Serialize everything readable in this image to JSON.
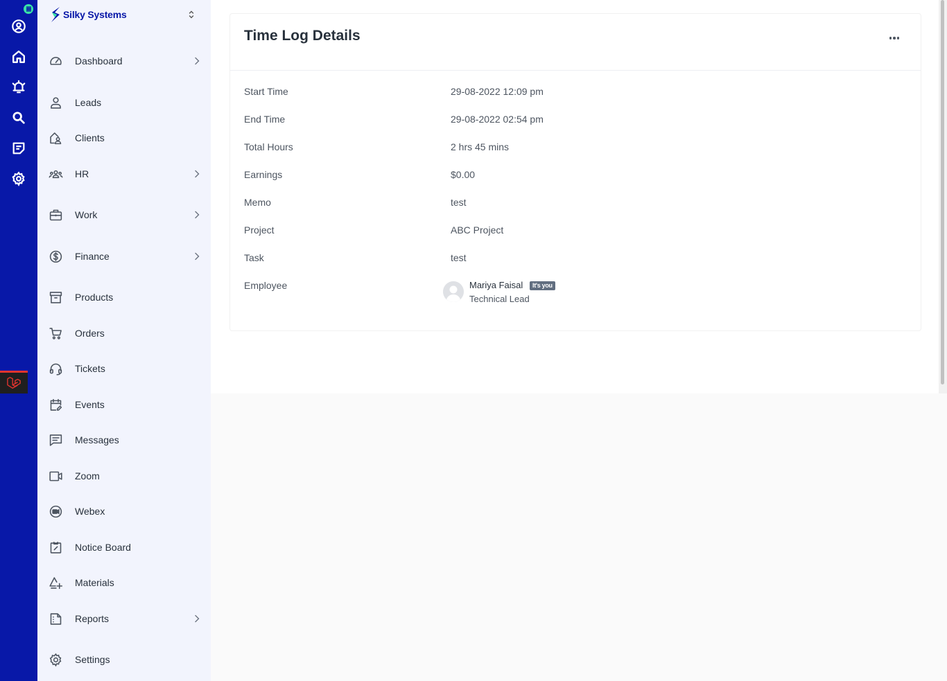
{
  "brand": {
    "name": "Silky Systems"
  },
  "rail": {
    "icons": [
      "user-circle-icon",
      "home-icon",
      "bell-icon",
      "search-icon",
      "sticky-note-icon",
      "gear-icon"
    ],
    "accent": "#0818a8",
    "notification_color": "#39e3a6"
  },
  "sidebar": {
    "items": [
      {
        "label": "Dashboard",
        "icon": "speedometer-icon",
        "has_submenu": true
      },
      {
        "label": "Leads",
        "icon": "person-icon",
        "has_submenu": false
      },
      {
        "label": "Clients",
        "icon": "person-house-icon",
        "has_submenu": false
      },
      {
        "label": "HR",
        "icon": "people-icon",
        "has_submenu": true
      },
      {
        "label": "Work",
        "icon": "briefcase-icon",
        "has_submenu": true
      },
      {
        "label": "Finance",
        "icon": "dollar-circle-icon",
        "has_submenu": true
      },
      {
        "label": "Products",
        "icon": "archive-box-icon",
        "has_submenu": false
      },
      {
        "label": "Orders",
        "icon": "cart-icon",
        "has_submenu": false
      },
      {
        "label": "Tickets",
        "icon": "headset-icon",
        "has_submenu": false
      },
      {
        "label": "Events",
        "icon": "calendar-edit-icon",
        "has_submenu": false
      },
      {
        "label": "Messages",
        "icon": "chat-icon",
        "has_submenu": false
      },
      {
        "label": "Zoom",
        "icon": "video-camera-icon",
        "has_submenu": false
      },
      {
        "label": "Webex",
        "icon": "webex-icon",
        "has_submenu": false
      },
      {
        "label": "Notice Board",
        "icon": "clipboard-icon",
        "has_submenu": false
      },
      {
        "label": "Materials",
        "icon": "shapes-plus-icon",
        "has_submenu": false
      },
      {
        "label": "Reports",
        "icon": "file-report-icon",
        "has_submenu": true
      },
      {
        "label": "Settings",
        "icon": "gear-icon",
        "has_submenu": false
      }
    ]
  },
  "card": {
    "title": "Time Log Details",
    "details": [
      {
        "label": "Start Time",
        "value": "29-08-2022 12:09 pm"
      },
      {
        "label": "End Time",
        "value": "29-08-2022 02:54 pm"
      },
      {
        "label": "Total Hours",
        "value": "2 hrs 45 mins"
      },
      {
        "label": "Earnings",
        "value": "$0.00"
      },
      {
        "label": "Memo",
        "value": "test"
      },
      {
        "label": "Project",
        "value": "ABC Project"
      },
      {
        "label": "Task",
        "value": "test"
      },
      {
        "label": "Employee",
        "value": ""
      }
    ],
    "employee": {
      "name": "Mariya Faisal",
      "badge": "It's you",
      "role": "Technical Lead"
    }
  }
}
